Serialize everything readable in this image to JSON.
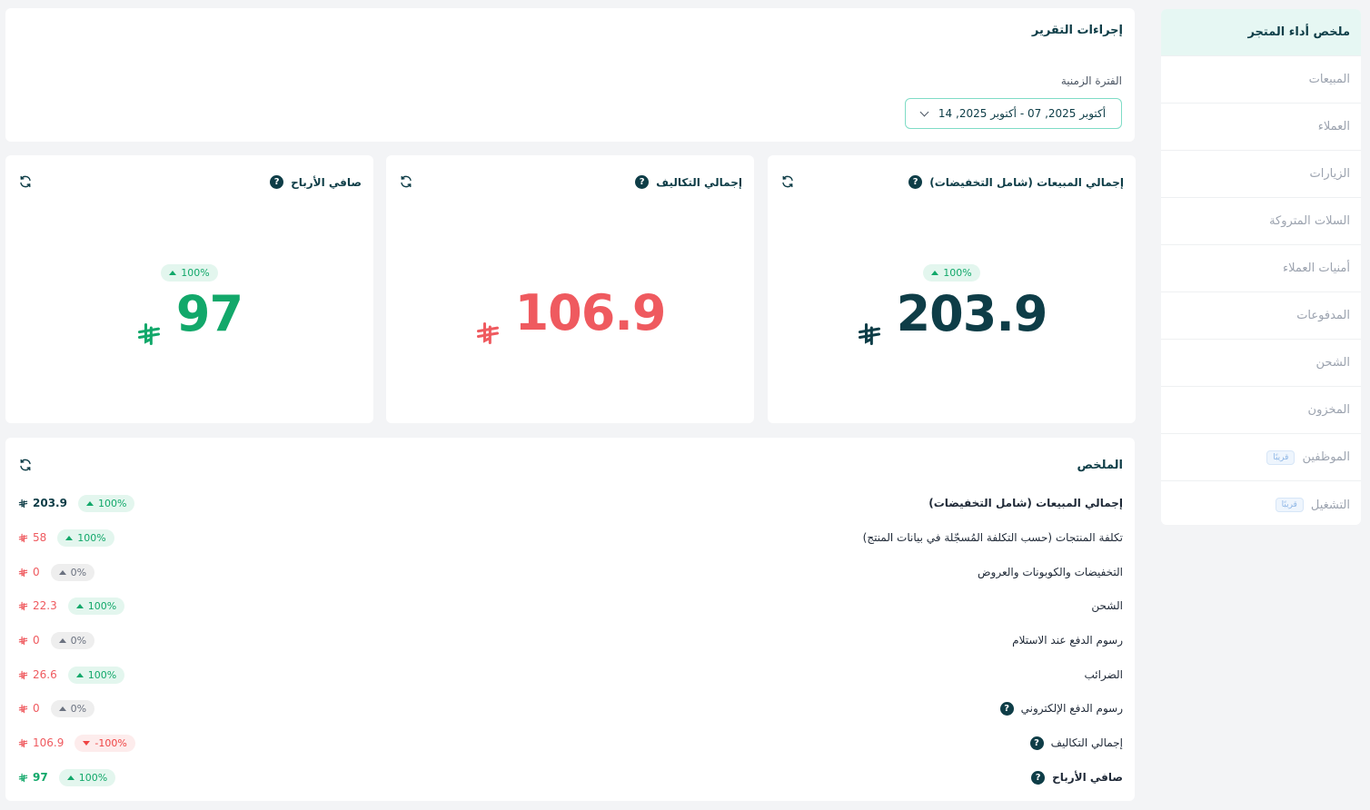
{
  "sidebar": {
    "items": [
      {
        "label": "ملخص أداء المتجر",
        "active": true
      },
      {
        "label": "المبيعات"
      },
      {
        "label": "العملاء"
      },
      {
        "label": "الزيارات"
      },
      {
        "label": "السلات المتروكة"
      },
      {
        "label": "أمنيات العملاء"
      },
      {
        "label": "المدفوعات"
      },
      {
        "label": "الشحن"
      },
      {
        "label": "المخزون"
      },
      {
        "label": "الموظفين",
        "badge": "قريبًا"
      },
      {
        "label": "التشغيل",
        "badge": "قريبًا"
      }
    ]
  },
  "actions": {
    "title": "إجراءات التقرير",
    "period_label": "الفترة الزمنية",
    "date_range": "أكتوبر 2025, 07  -  أكتوبر 2025, 14"
  },
  "kpis": {
    "sales": {
      "title": "إجمالي المبيعات (شامل التخفيضات)",
      "change": "100%",
      "value": "203.9"
    },
    "costs": {
      "title": "إجمالي التكاليف",
      "value": "106.9"
    },
    "profit": {
      "title": "صافي الأرباح",
      "change": "100%",
      "value": "97"
    }
  },
  "summary": {
    "title": "الملخص",
    "rows": [
      {
        "label": "إجمالي المبيعات (شامل التخفيضات)",
        "change": "100%",
        "value": "203.9"
      },
      {
        "label": "تكلفة المنتجات (حسب التكلفة المُسجّلة في بيانات المنتج)",
        "change": "100%",
        "value": "58"
      },
      {
        "label": "التخفيضات والكوبونات والعروض",
        "change": "0%",
        "value": "0"
      },
      {
        "label": "الشحن",
        "change": "100%",
        "value": "22.3"
      },
      {
        "label": "رسوم الدفع عند الاستلام",
        "change": "0%",
        "value": "0"
      },
      {
        "label": "الضرائب",
        "change": "100%",
        "value": "26.6"
      },
      {
        "label": "رسوم الدفع الإلكتروني",
        "change": "0%",
        "value": "0"
      },
      {
        "label": "إجمالي التكاليف",
        "change": "-100%",
        "value": "106.9"
      },
      {
        "label": "صافي الأرباح",
        "change": "100%",
        "value": "97"
      }
    ]
  },
  "icons": {
    "help": "?",
    "refresh": "refresh-icon",
    "currency": "riyal-icon"
  },
  "colors": {
    "navy": "#0e3d47",
    "green": "#12a86a",
    "red": "#ef5a5f",
    "accent": "#7fdcc6"
  }
}
